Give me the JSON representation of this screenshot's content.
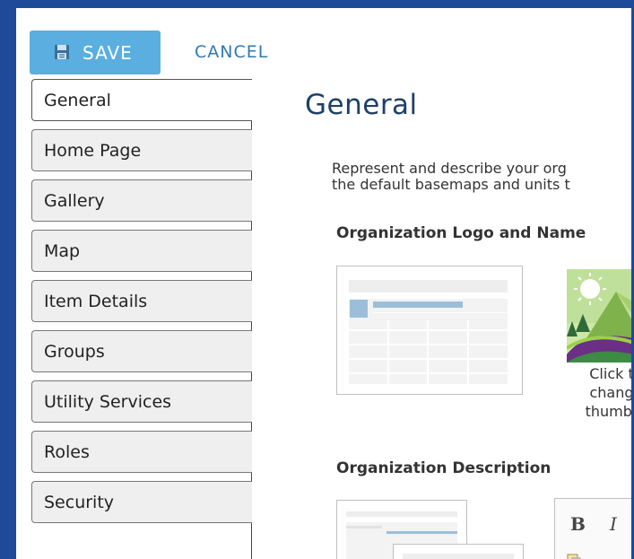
{
  "toolbar": {
    "save_label": "SAVE",
    "save_icon": "floppy-disk-icon",
    "cancel_label": "CANCEL",
    "accent_color": "#5aaee0",
    "link_color": "#2f7ab7"
  },
  "sidebar": {
    "items": [
      {
        "label": "General",
        "active": true
      },
      {
        "label": "Home Page",
        "active": false
      },
      {
        "label": "Gallery",
        "active": false
      },
      {
        "label": "Map",
        "active": false
      },
      {
        "label": "Item Details",
        "active": false
      },
      {
        "label": "Groups",
        "active": false
      },
      {
        "label": "Utility Services",
        "active": false
      },
      {
        "label": "Roles",
        "active": false
      },
      {
        "label": "Security",
        "active": false
      }
    ]
  },
  "main": {
    "title": "General",
    "intro_line1": "Represent and describe your org",
    "intro_line2": "the default basemaps and units t",
    "logo_section": {
      "heading": "Organization Logo and Name",
      "caption_line1": "Click t",
      "caption_line2": "chang",
      "caption_line3": "thumbr"
    },
    "description_section": {
      "heading": "Organization Description",
      "editor_bold": "B",
      "editor_italic": "I"
    }
  }
}
